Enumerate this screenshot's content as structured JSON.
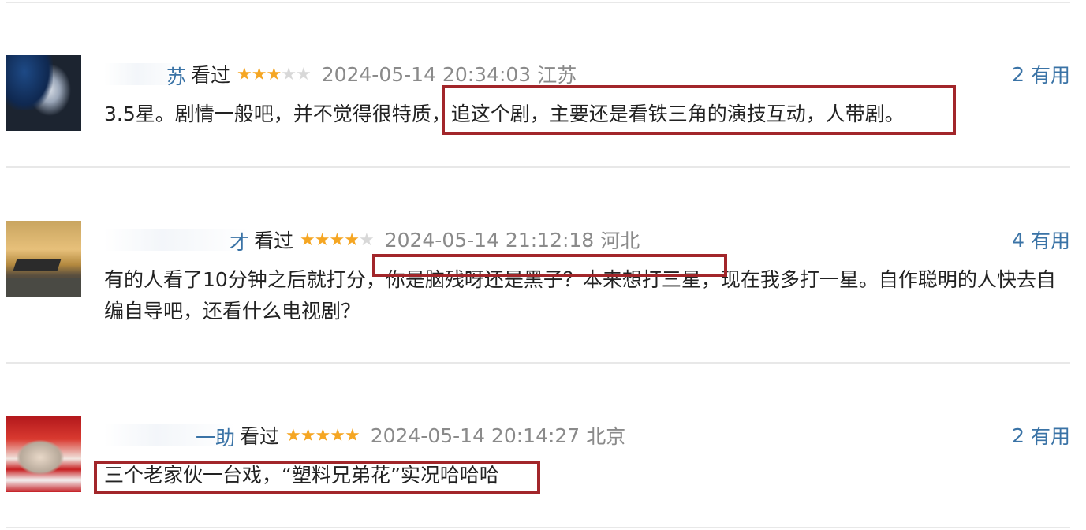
{
  "comments": [
    {
      "user_visible": "苏",
      "watched_label": "看过",
      "rating": 3,
      "rating_max": 5,
      "time": "2024-05-14 20:34:03",
      "location": "江苏",
      "useful_count": "2",
      "useful_label": "有用",
      "text": "3.5星。剧情一般吧，并不觉得很特质，追这个剧，主要还是看铁三角的演技互动，人带剧。"
    },
    {
      "user_visible": "才",
      "watched_label": "看过",
      "rating": 4,
      "rating_max": 5,
      "time": "2024-05-14 21:12:18",
      "location": "河北",
      "useful_count": "4",
      "useful_label": "有用",
      "text": "有的人看了10分钟之后就打分，你是脑残呀还是黑子？本来想打三星，现在我多打一星。自作聪明的人快去自编自导吧，还看什么电视剧？"
    },
    {
      "user_visible": "一助",
      "watched_label": "看过",
      "rating": 5,
      "rating_max": 5,
      "time": "2024-05-14 20:14:27",
      "location": "北京",
      "useful_count": "2",
      "useful_label": "有用",
      "text": "三个老家伙一台戏，“塑料兄弟花”实况哈哈哈"
    }
  ],
  "colors": {
    "link": "#3a73a6",
    "star_on": "#f5a623",
    "star_off": "#d8d8d8",
    "meta_gray": "#8a8a8a",
    "highlight": "#a2262a"
  }
}
